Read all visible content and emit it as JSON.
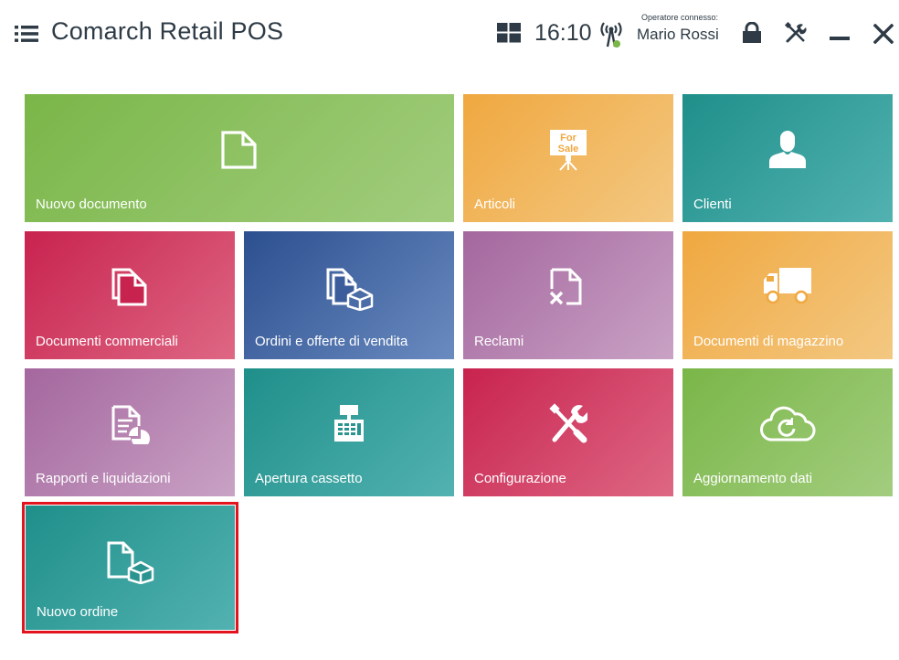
{
  "header": {
    "title": "Comarch Retail POS",
    "time": "16:10",
    "operator_label": "Operatore connesso:",
    "operator_name": "Mario Rossi",
    "icons": [
      "menu-icon",
      "windows-icon",
      "network-icon",
      "lock-icon",
      "tools-icon",
      "minimize-icon",
      "close-icon"
    ]
  },
  "tiles": [
    {
      "label": "Nuovo documento",
      "icon": "document-icon",
      "color": "#7ab648"
    },
    {
      "label": "Articoli",
      "icon": "for-sale-sign-icon",
      "icon_text": [
        "For",
        "Sale"
      ],
      "color": "#f0a840"
    },
    {
      "label": "Clienti",
      "icon": "person-icon",
      "color": "#1f8f8a"
    },
    {
      "label": "Documenti commerciali",
      "icon": "documents-icon",
      "color": "#c8234f"
    },
    {
      "label": "Ordini e offerte di vendita",
      "icon": "document-box-icon",
      "color": "#2c4f8f"
    },
    {
      "label": "Reclami",
      "icon": "document-x-icon",
      "color": "#a4679e"
    },
    {
      "label": "Documenti di magazzino",
      "icon": "truck-icon",
      "color": "#f0a840"
    },
    {
      "label": "Rapporti e liquidazioni",
      "icon": "report-chart-icon",
      "color": "#a4679e"
    },
    {
      "label": "Apertura cassetto",
      "icon": "cash-register-icon",
      "color": "#1f8f8a"
    },
    {
      "label": "Configurazione",
      "icon": "tools-icon",
      "color": "#c8234f"
    },
    {
      "label": "Aggiornamento dati",
      "icon": "cloud-refresh-icon",
      "color": "#7ab648"
    },
    {
      "label": "Nuovo ordine",
      "icon": "document-box-icon",
      "color": "#1f8f8a",
      "selected": true
    }
  ],
  "colors": {
    "selection_border": "#e3141d",
    "header_text": "#2e3b46"
  }
}
